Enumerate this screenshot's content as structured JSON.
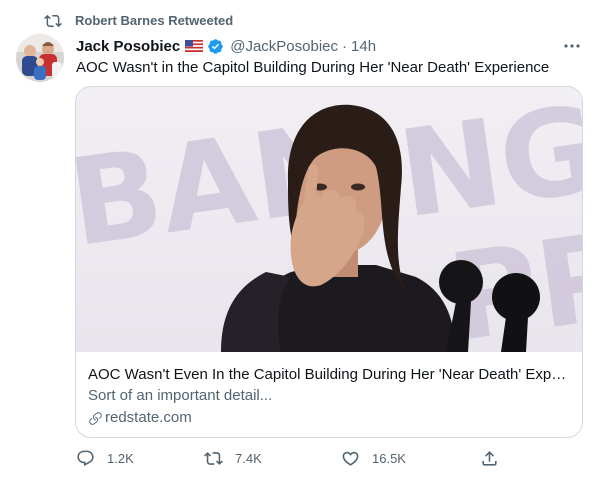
{
  "retweet_banner": {
    "text": "Robert Barnes Retweeted"
  },
  "author": {
    "name": "Jack Posobiec",
    "handle": "@JackPosobiec",
    "separator": "·",
    "time": "14h"
  },
  "tweet": {
    "text": "AOC Wasn't in the Capitol Building During Her 'Near Death' Experience"
  },
  "link_card": {
    "title": "AOC Wasn't Even In the Capitol Building During Her 'Near Death' Experi...",
    "description": "Sort of an important detail...",
    "domain": "redstate.com"
  },
  "actions": {
    "reply_count": "1.2K",
    "retweet_count": "7.4K",
    "like_count": "16.5K"
  },
  "icons": [
    "retweet-icon",
    "flag-icon",
    "verified-badge-icon",
    "more-icon",
    "link-icon",
    "reply-icon",
    "like-icon",
    "share-icon"
  ],
  "colors": {
    "secondary_text": "#536471",
    "verified_blue": "#1d9bf0",
    "border": "#cfd9de"
  }
}
